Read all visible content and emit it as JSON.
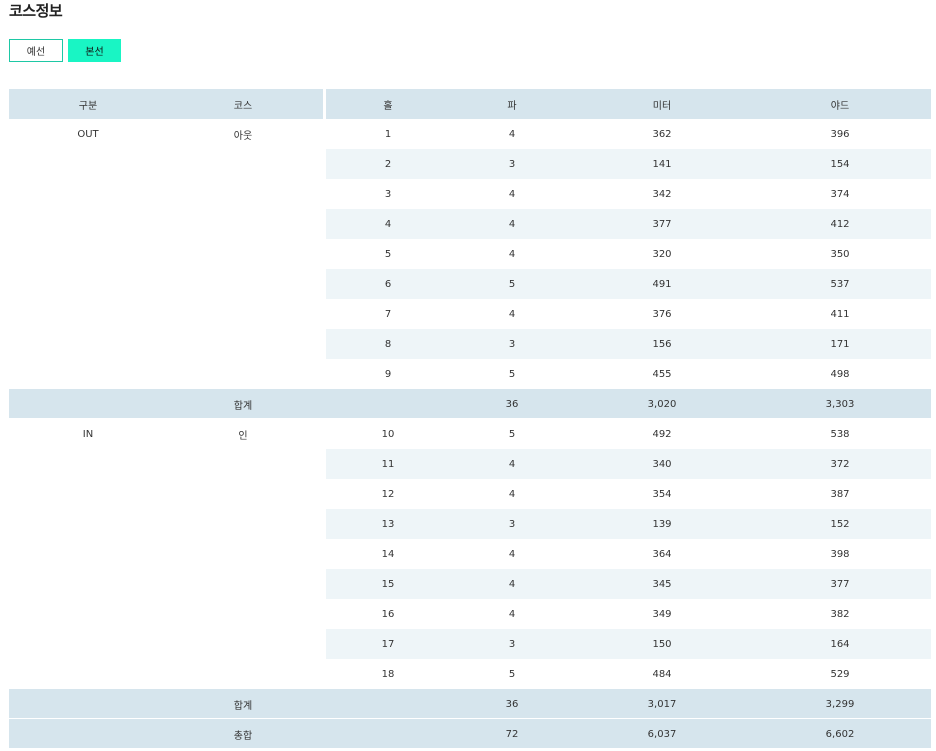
{
  "page": {
    "title": "코스정보"
  },
  "tabs": [
    {
      "label": "예선",
      "selected": false
    },
    {
      "label": "본선",
      "selected": true
    }
  ],
  "colors": {
    "accent": "#19f5c4",
    "header_bg": "#d6e5ed",
    "stripe_bg": "#eef5f8"
  },
  "table": {
    "headers": [
      "구분",
      "코스",
      "홀",
      "파",
      "미터",
      "야드"
    ],
    "rows": [
      {
        "type": "hole",
        "group": "OUT",
        "course": "아웃",
        "hole": "1",
        "par": "4",
        "meter": "362",
        "yard": "396"
      },
      {
        "type": "hole",
        "group": "",
        "course": "",
        "hole": "2",
        "par": "3",
        "meter": "141",
        "yard": "154"
      },
      {
        "type": "hole",
        "group": "",
        "course": "",
        "hole": "3",
        "par": "4",
        "meter": "342",
        "yard": "374"
      },
      {
        "type": "hole",
        "group": "",
        "course": "",
        "hole": "4",
        "par": "4",
        "meter": "377",
        "yard": "412"
      },
      {
        "type": "hole",
        "group": "",
        "course": "",
        "hole": "5",
        "par": "4",
        "meter": "320",
        "yard": "350"
      },
      {
        "type": "hole",
        "group": "",
        "course": "",
        "hole": "6",
        "par": "5",
        "meter": "491",
        "yard": "537"
      },
      {
        "type": "hole",
        "group": "",
        "course": "",
        "hole": "7",
        "par": "4",
        "meter": "376",
        "yard": "411"
      },
      {
        "type": "hole",
        "group": "",
        "course": "",
        "hole": "8",
        "par": "3",
        "meter": "156",
        "yard": "171"
      },
      {
        "type": "hole",
        "group": "",
        "course": "",
        "hole": "9",
        "par": "5",
        "meter": "455",
        "yard": "498"
      },
      {
        "type": "sum",
        "label": "합계",
        "par": "36",
        "meter": "3,020",
        "yard": "3,303"
      },
      {
        "type": "hole",
        "group": "IN",
        "course": "인",
        "hole": "10",
        "par": "5",
        "meter": "492",
        "yard": "538"
      },
      {
        "type": "hole",
        "group": "",
        "course": "",
        "hole": "11",
        "par": "4",
        "meter": "340",
        "yard": "372"
      },
      {
        "type": "hole",
        "group": "",
        "course": "",
        "hole": "12",
        "par": "4",
        "meter": "354",
        "yard": "387"
      },
      {
        "type": "hole",
        "group": "",
        "course": "",
        "hole": "13",
        "par": "3",
        "meter": "139",
        "yard": "152"
      },
      {
        "type": "hole",
        "group": "",
        "course": "",
        "hole": "14",
        "par": "4",
        "meter": "364",
        "yard": "398"
      },
      {
        "type": "hole",
        "group": "",
        "course": "",
        "hole": "15",
        "par": "4",
        "meter": "345",
        "yard": "377"
      },
      {
        "type": "hole",
        "group": "",
        "course": "",
        "hole": "16",
        "par": "4",
        "meter": "349",
        "yard": "382"
      },
      {
        "type": "hole",
        "group": "",
        "course": "",
        "hole": "17",
        "par": "3",
        "meter": "150",
        "yard": "164"
      },
      {
        "type": "hole",
        "group": "",
        "course": "",
        "hole": "18",
        "par": "5",
        "meter": "484",
        "yard": "529"
      },
      {
        "type": "sum",
        "label": "합계",
        "par": "36",
        "meter": "3,017",
        "yard": "3,299"
      },
      {
        "type": "sum",
        "label": "총합",
        "par": "72",
        "meter": "6,037",
        "yard": "6,602"
      }
    ]
  }
}
